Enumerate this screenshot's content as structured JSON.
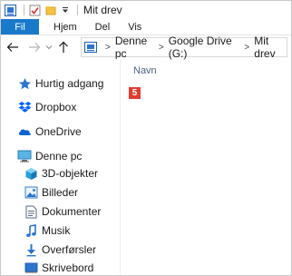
{
  "window": {
    "title": "Mit drev"
  },
  "ribbon": {
    "tabs": [
      "Fil",
      "Hjem",
      "Del",
      "Vis"
    ]
  },
  "address": {
    "crumbs": [
      "Denne pc",
      "Google Drive (G:)",
      "Mit drev"
    ]
  },
  "nav": {
    "items": [
      {
        "label": "Hurtig adgang",
        "icon": "star-icon"
      },
      {
        "label": "Dropbox",
        "icon": "dropbox-icon"
      },
      {
        "label": "OneDrive",
        "icon": "cloud-icon"
      },
      {
        "label": "Denne pc",
        "icon": "computer-icon"
      },
      {
        "label": "3D-objekter",
        "icon": "cube-icon"
      },
      {
        "label": "Billeder",
        "icon": "pictures-icon"
      },
      {
        "label": "Dokumenter",
        "icon": "documents-icon"
      },
      {
        "label": "Musik",
        "icon": "music-icon"
      },
      {
        "label": "Overførsler",
        "icon": "download-icon"
      },
      {
        "label": "Skrivebord",
        "icon": "desktop-icon"
      }
    ]
  },
  "content": {
    "column_header": "Navn",
    "badge": "5"
  },
  "colors": {
    "file_tab": "#1979ca",
    "badge": "#e03c31",
    "header_text": "#4d6082"
  }
}
